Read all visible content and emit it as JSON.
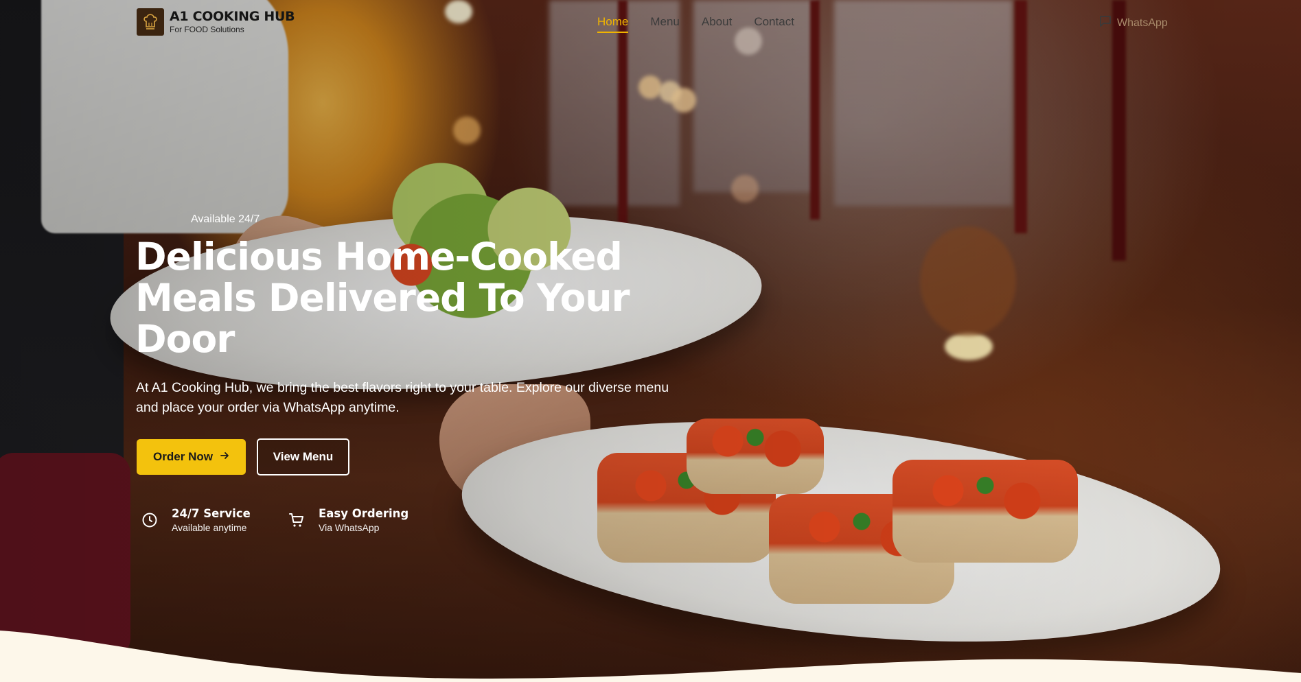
{
  "brand": {
    "title": "A1 COOKING HUB",
    "subtitle": "For FOOD Solutions"
  },
  "nav": {
    "links": [
      {
        "label": "Home",
        "active": true
      },
      {
        "label": "Menu",
        "active": false
      },
      {
        "label": "About",
        "active": false
      },
      {
        "label": "Contact",
        "active": false
      }
    ],
    "whatsapp_label": "WhatsApp"
  },
  "hero": {
    "badge": "Available 24/7",
    "headline": "Delicious Home-Cooked Meals Delivered To Your Door",
    "description": "At A1 Cooking Hub, we bring the best flavors right to your table. Explore our diverse menu and place your order via WhatsApp anytime.",
    "order_button": "Order Now",
    "menu_button": "View Menu"
  },
  "features": [
    {
      "icon": "clock-icon",
      "title": "24/7 Service",
      "subtitle": "Available anytime"
    },
    {
      "icon": "cart-icon",
      "title": "Easy Ordering",
      "subtitle": "Via WhatsApp"
    }
  ],
  "colors": {
    "accent": "#f3c20d",
    "nav_active": "#f0b400",
    "wave": "#fdf7ea"
  }
}
